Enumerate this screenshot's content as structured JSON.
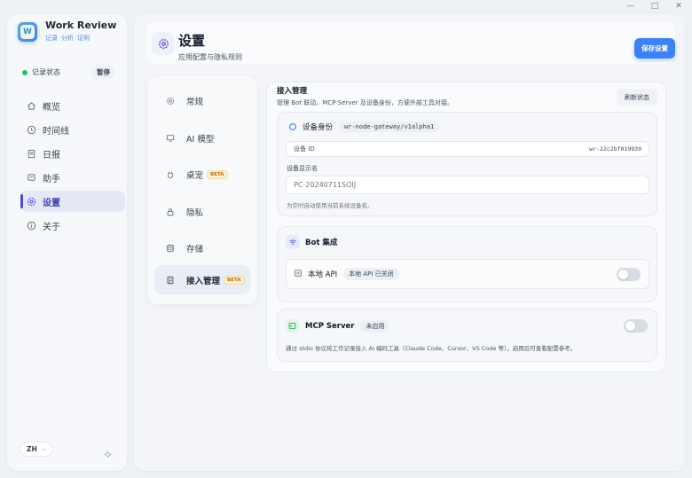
{
  "window": {
    "minimize": "—",
    "maximize": "□",
    "close": "✕"
  },
  "app": {
    "name": "Work Review",
    "logo_letter": "W",
    "tabs": [
      "记录",
      "分析",
      "证明"
    ]
  },
  "status": {
    "label": "记录状态",
    "pause": "暂停",
    "dot_color": "#22c55e"
  },
  "nav": [
    {
      "label": "概览",
      "icon": "home-icon"
    },
    {
      "label": "时间线",
      "icon": "clock-icon"
    },
    {
      "label": "日报",
      "icon": "document-icon"
    },
    {
      "label": "助手",
      "icon": "chat-icon"
    },
    {
      "label": "设置",
      "icon": "gear-icon",
      "active": true
    },
    {
      "label": "关于",
      "icon": "info-icon"
    }
  ],
  "lang": {
    "value": "ZH"
  },
  "header": {
    "title": "设置",
    "subtitle": "应用配置与隐私规则",
    "save": "保存设置"
  },
  "subnav": [
    {
      "label": "常规",
      "icon": "gear-icon"
    },
    {
      "label": "AI 模型",
      "icon": "monitor-icon"
    },
    {
      "label": "桌宠",
      "icon": "pet-icon",
      "badge": "BETA"
    },
    {
      "label": "隐私",
      "icon": "lock-icon"
    },
    {
      "label": "存储",
      "icon": "database-icon"
    },
    {
      "label": "接入管理",
      "icon": "plug-icon",
      "badge": "BETA",
      "active": true
    }
  ],
  "integration": {
    "title": "接入管理",
    "description": "管理 Bot 联动、MCP Server 及设备身份，方便外部工具对接。",
    "refresh": "刷新状态",
    "identity": {
      "title": "设备身份",
      "gateway": "wr-node-gateway/v1alpha1",
      "device_id_label": "设备 ID",
      "device_id_value": "wr-22c2bf019939",
      "display_name_label": "设备显示名",
      "display_name_placeholder": "PC-20240711SOIJ",
      "hint": "为空时自动使用当前系统设备名。"
    },
    "bot": {
      "title": "Bot 集成",
      "local_api_label": "本地 API",
      "local_api_status": "本地 API 已关闭"
    },
    "mcp": {
      "title": "MCP Server",
      "status": "未启用",
      "description": "通过 stdio 协议将工作记录接入 AI 编码工具（Claude Code、Cursor、VS Code 等），启用后可查看配置参考。"
    }
  },
  "colors": {
    "accent": "#3b82f6",
    "active_nav": "#4f46e5",
    "beta_text": "#c2700b"
  }
}
